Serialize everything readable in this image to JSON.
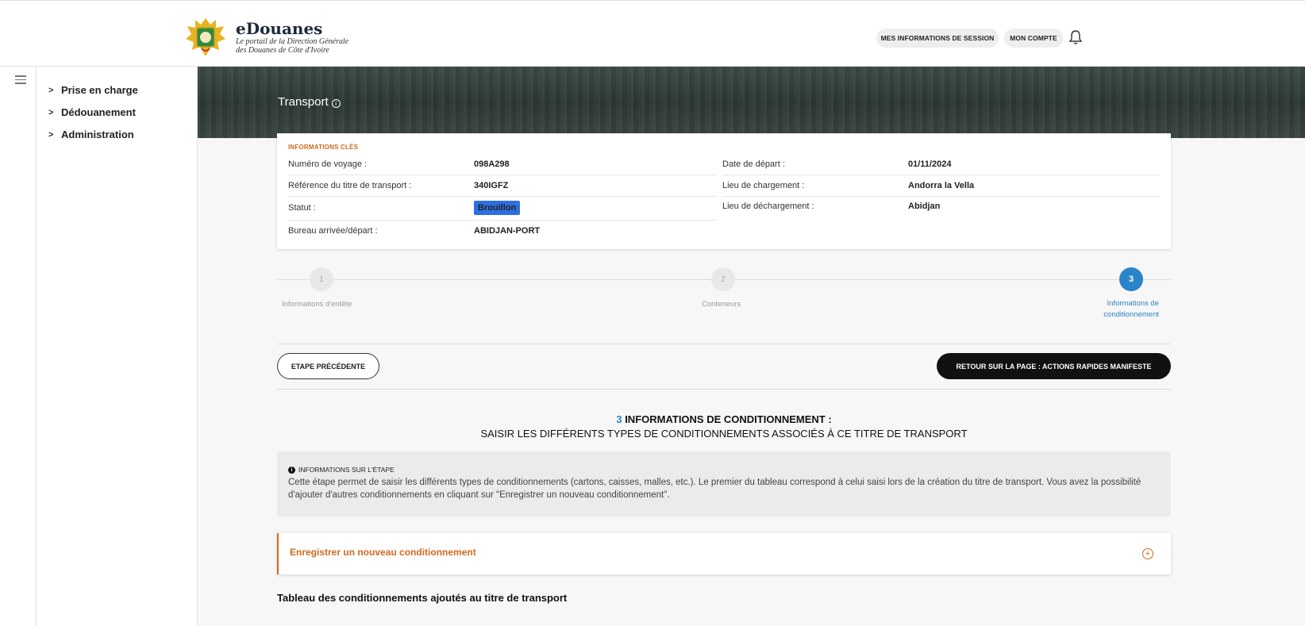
{
  "header": {
    "brand_title": "eDouanes",
    "brand_sub_1": "Le portail de la Direction Générale",
    "brand_sub_2": "des Douanes de Côte d'Ivoire",
    "session_button": "MES INFORMATIONS DE SESSION",
    "account_button": "MON COMPTE"
  },
  "sidebar": {
    "items": [
      {
        "label": "Prise en charge"
      },
      {
        "label": "Dédouanement"
      },
      {
        "label": "Administration"
      }
    ]
  },
  "banner": {
    "title": "Transport"
  },
  "key_info": {
    "heading": "INFORMATIONS CLÉS",
    "left": [
      {
        "label": "Numéro de voyage :",
        "value": "098A298"
      },
      {
        "label": "Référence du titre de transport :",
        "value": "340IGFZ"
      },
      {
        "label": "Statut :",
        "value": "Brouillon"
      },
      {
        "label": "Bureau arrivée/départ :",
        "value": "ABIDJAN-PORT"
      }
    ],
    "right": [
      {
        "label": "Date de départ :",
        "value": "01/11/2024"
      },
      {
        "label": "Lieu de chargement :",
        "value": "Andorra la Vella"
      },
      {
        "label": "Lieu de déchargement :",
        "value": "Abidjan"
      }
    ]
  },
  "stepper": {
    "steps": [
      {
        "number": "1",
        "label": "Informations d'entête"
      },
      {
        "number": "2",
        "label": "Conteneurs"
      },
      {
        "number": "3",
        "label_line1": "Informations de",
        "label_line2": "conditionnement"
      }
    ]
  },
  "actions": {
    "prev_button": "ETAPE PRÉCÉDENTE",
    "back_button": "RETOUR SUR LA PAGE : ACTIONS RAPIDES MANIFESTE"
  },
  "section": {
    "number": "3",
    "title_line1": "INFORMATIONS DE CONDITIONNEMENT :",
    "title_line2": "SAISIR LES DIFFÉRENTS TYPES DE CONDITIONNEMENTS ASSOCIÉS À CE TITRE DE TRANSPORT"
  },
  "info_box": {
    "heading": "INFORMATIONS SUR L'ÉTAPE",
    "text": "Cette étape permet de saisir les différents types de conditionnements (cartons, caisses, malles, etc.). Le premier du tableau correspond à celui saisi lors de la création du titre de transport. Vous avez la possibilité d'ajouter d'autres conditionnements en cliquant sur \"Enregistrer un nouveau conditionnement\"."
  },
  "accordion": {
    "label": "Enregistrer un nouveau conditionnement"
  },
  "table": {
    "title": "Tableau des conditionnements ajoutés au titre de transport"
  },
  "colors": {
    "accent_orange": "#d2691e",
    "step_active": "#2a84c9",
    "badge_blue": "#2e6fe0"
  }
}
